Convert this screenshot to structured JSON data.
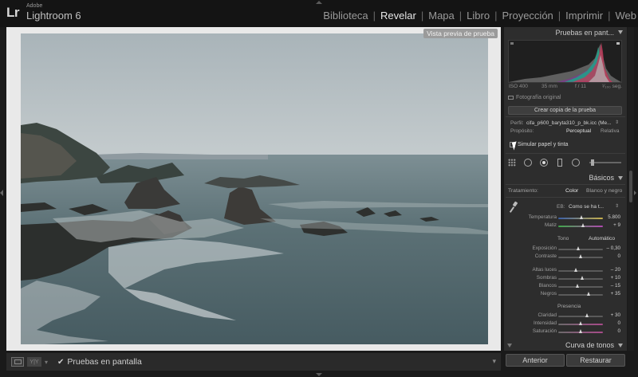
{
  "app": {
    "logo": "Lr",
    "brand_small": "Adobe",
    "brand_name": "Lightroom 6"
  },
  "modules": [
    {
      "label": "Biblioteca",
      "active": false
    },
    {
      "label": "Revelar",
      "active": true
    },
    {
      "label": "Mapa",
      "active": false
    },
    {
      "label": "Libro",
      "active": false
    },
    {
      "label": "Proyección",
      "active": false
    },
    {
      "label": "Imprimir",
      "active": false
    },
    {
      "label": "Web",
      "active": false
    }
  ],
  "main": {
    "preview_label": "Vista previa de prueba"
  },
  "toolbar": {
    "checkmark": "✔",
    "softproof_label": "Pruebas en pantalla"
  },
  "panel": {
    "softproof_header": "Pruebas en pant...",
    "histogram_info": {
      "iso": "ISO 400",
      "focal": "35 mm",
      "aperture": "f / 11",
      "shutter": "¹⁄₁₀₀ seg."
    },
    "original_photo": "Fotografía original",
    "create_copy_button": "Crear copia de la prueba",
    "profile_label": "Perfil:",
    "profile_value": "cifa_p600_baryta310_p_bk.icc (Me...",
    "intent_label": "Propósito:",
    "intent_perceptual": "Perceptual",
    "intent_relative": "Relativa",
    "simulate_label": "Simular papel y tinta",
    "basic_header": "Básicos",
    "treatment_label": "Tratamiento:",
    "treatment_color": "Color",
    "treatment_bw": "Blanco y negro",
    "wb_label": "EB:",
    "wb_value": "Como se ha t...",
    "tone_title": "Tono",
    "tone_auto": "Automático",
    "presence_title": "Presencia",
    "tone_curve_header": "Curva de tonos",
    "prev_button": "Anterior",
    "reset_button": "Restaurar"
  },
  "sliders": {
    "temperatura": {
      "label": "Temperatura",
      "value": "5.800",
      "pos": 0.52
    },
    "matiz": {
      "label": "Matiz",
      "value": "+ 9",
      "pos": 0.56
    },
    "exposicion": {
      "label": "Exposición",
      "value": "– 0,30",
      "pos": 0.45
    },
    "contraste": {
      "label": "Contraste",
      "value": "0",
      "pos": 0.5
    },
    "altas_luces": {
      "label": "Altas luces",
      "value": "– 20",
      "pos": 0.4
    },
    "sombras": {
      "label": "Sombras",
      "value": "+ 10",
      "pos": 0.55
    },
    "blancos": {
      "label": "Blancos",
      "value": "– 15",
      "pos": 0.43
    },
    "negros": {
      "label": "Negros",
      "value": "+ 35",
      "pos": 0.68
    },
    "claridad": {
      "label": "Claridad",
      "value": "+ 30",
      "pos": 0.65
    },
    "intensidad": {
      "label": "Intensidad",
      "value": "0",
      "pos": 0.5
    },
    "saturacion": {
      "label": "Saturación",
      "value": "0",
      "pos": 0.5
    }
  }
}
